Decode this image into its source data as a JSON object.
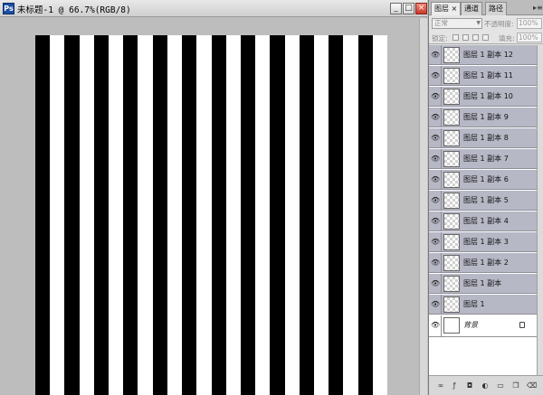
{
  "document": {
    "app_icon": "Ps",
    "title": "未标题-1 @ 66.7%(RGB/8)",
    "minimize": "_",
    "maximize": "□",
    "close": "×"
  },
  "canvas": {
    "stripe_count": 12,
    "stripe_color": "#000000",
    "background_color": "#ffffff"
  },
  "layers_panel": {
    "tabs": [
      {
        "label": "图层 ×"
      },
      {
        "label": "通道"
      },
      {
        "label": "路径"
      }
    ],
    "menu_icon": "▸≡",
    "blend_mode": "正常",
    "opacity_label": "不透明度:",
    "opacity_value": "100%",
    "lock_label": "锁定:",
    "fill_label": "填充:",
    "fill_value": "100%",
    "layers": [
      {
        "name": "图层 1 副本 12"
      },
      {
        "name": "图层 1 副本 11"
      },
      {
        "name": "图层 1 副本 10"
      },
      {
        "name": "图层 1 副本 9"
      },
      {
        "name": "图层 1 副本 8"
      },
      {
        "name": "图层 1 副本 7"
      },
      {
        "name": "图层 1 副本 6"
      },
      {
        "name": "图层 1 副本 5"
      },
      {
        "name": "图层 1 副本 4"
      },
      {
        "name": "图层 1 副本 3"
      },
      {
        "name": "图层 1 副本 2"
      },
      {
        "name": "图层 1 副本"
      },
      {
        "name": "图层 1"
      }
    ],
    "background_layer": {
      "name": "背景"
    },
    "footer_icons": [
      "link-icon",
      "fx-icon",
      "mask-icon",
      "adjustment-icon",
      "folder-icon",
      "new-layer-icon",
      "trash-icon"
    ]
  }
}
